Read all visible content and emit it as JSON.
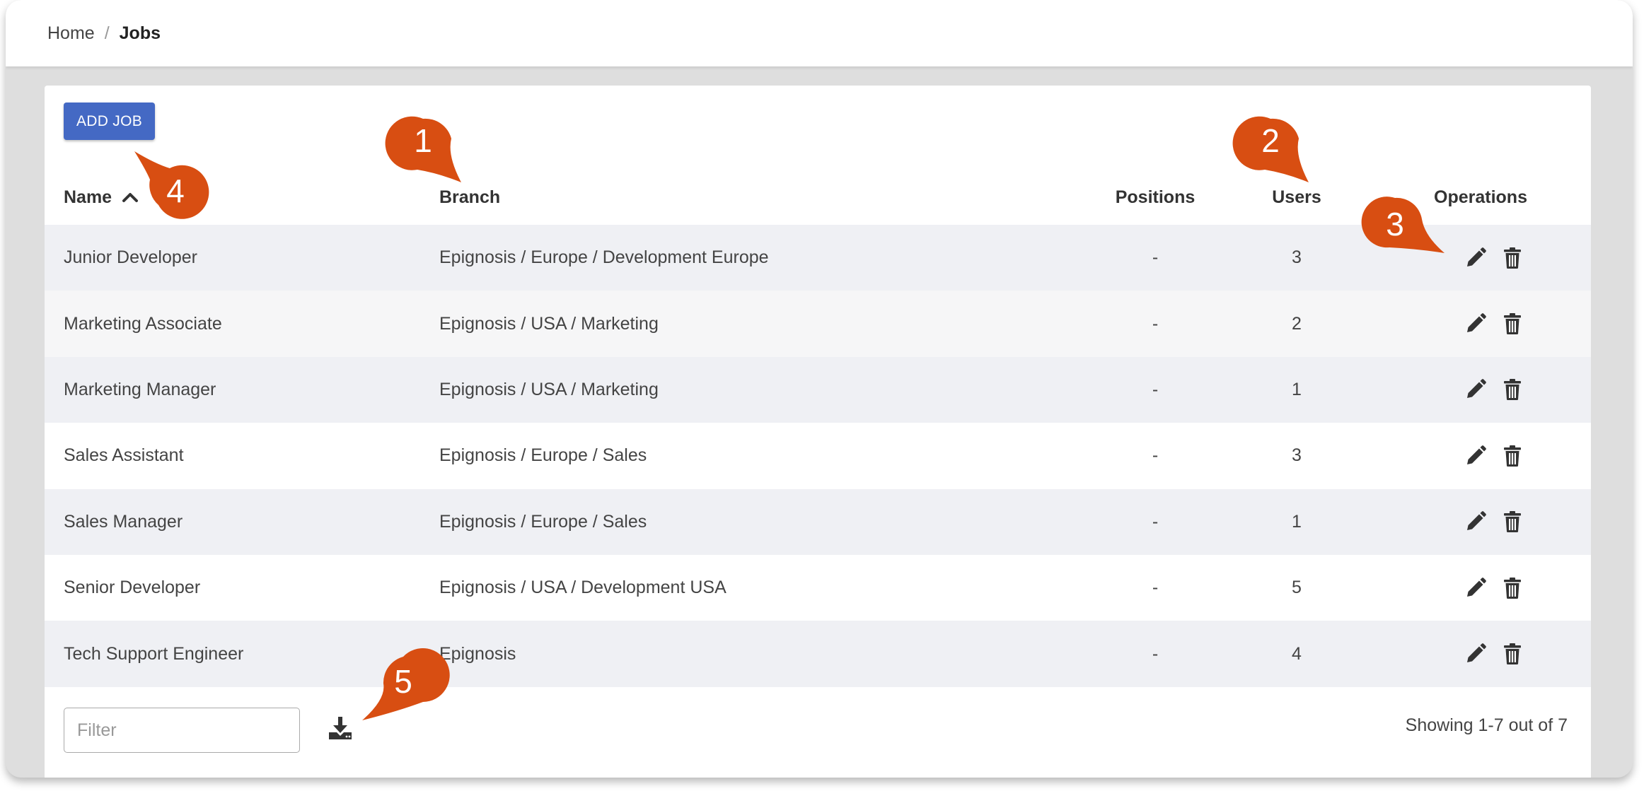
{
  "breadcrumb": {
    "home": "Home",
    "separator": "/",
    "current": "Jobs"
  },
  "toolbar": {
    "add_label": "ADD JOB"
  },
  "table": {
    "columns": {
      "name": "Name",
      "branch": "Branch",
      "positions": "Positions",
      "users": "Users",
      "operations": "Operations"
    },
    "sort": {
      "column": "Name",
      "direction": "ascending",
      "icon": "chevron-up-icon"
    },
    "rows": [
      {
        "name": "Junior Developer",
        "branch": "Epignosis / Europe / Development Europe",
        "positions": "-",
        "users": "3"
      },
      {
        "name": "Marketing Associate",
        "branch": "Epignosis / USA / Marketing",
        "positions": "-",
        "users": "2"
      },
      {
        "name": "Marketing Manager",
        "branch": "Epignosis / USA / Marketing",
        "positions": "-",
        "users": "1"
      },
      {
        "name": "Sales Assistant",
        "branch": "Epignosis / Europe / Sales",
        "positions": "-",
        "users": "3"
      },
      {
        "name": "Sales Manager",
        "branch": "Epignosis / Europe / Sales",
        "positions": "-",
        "users": "1"
      },
      {
        "name": "Senior Developer",
        "branch": "Epignosis / USA / Development USA",
        "positions": "-",
        "users": "5"
      },
      {
        "name": "Tech Support Engineer",
        "branch": "Epignosis",
        "positions": "-",
        "users": "4"
      }
    ],
    "operation_icons": [
      "pencil-icon",
      "trash-icon"
    ]
  },
  "footer": {
    "filter_placeholder": "Filter",
    "filter_value": "",
    "download_icon": "download-icon",
    "pager_info": "Showing 1-7 out of 7"
  },
  "callouts": [
    "1",
    "2",
    "3",
    "4",
    "5"
  ],
  "colors": {
    "primary": "#4469c4",
    "callout": "#d84e12",
    "row_odd": "#eff0f4",
    "row_even": "#f6f6f7",
    "icon": "#333333"
  }
}
